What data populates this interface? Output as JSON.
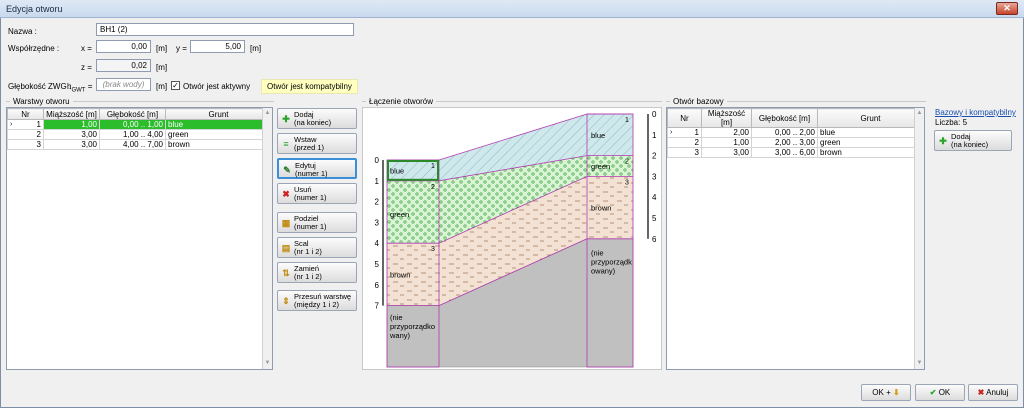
{
  "window": {
    "title": "Edycja otworu",
    "close_glyph": "✕"
  },
  "form": {
    "name_label": "Nazwa :",
    "name_value": "BH1 (2)",
    "coords_label": "Współrzędne :",
    "x_label": "x =",
    "x_value": "0,00",
    "y_label": "y =",
    "y_value": "5,00",
    "z_label": "z =",
    "z_value": "0,02",
    "unit_m": "[m]",
    "gwt_label": "Głębokość ZWG :",
    "gwt_symbol": "h",
    "gwt_sub": "GWT",
    "gwt_eq": "=",
    "gwt_placeholder": "(brak wody)",
    "active_checkbox_label": "Otwór jest aktywny",
    "active_checked": true,
    "compat_note": "Otwór jest kompatybilny"
  },
  "layers_panel": {
    "title": "Warstwy otworu",
    "columns": [
      "Nr",
      "Miąższość [m]",
      "Głębokość [m]",
      "Grunt"
    ],
    "rows": [
      {
        "nr": "1",
        "thickness": "1,00",
        "depth": "0,00 .. 1,00",
        "soil": "blue",
        "selected": true
      },
      {
        "nr": "2",
        "thickness": "3,00",
        "depth": "1,00 .. 4,00",
        "soil": "green",
        "selected": false
      },
      {
        "nr": "3",
        "thickness": "3,00",
        "depth": "4,00 .. 7,00",
        "soil": "brown",
        "selected": false
      }
    ]
  },
  "actions": [
    {
      "name": "add",
      "line1": "Dodaj",
      "line2": "(na koniec)",
      "icon": "plus-icon"
    },
    {
      "name": "insert",
      "line1": "Wstaw",
      "line2": "(przed 1)",
      "icon": "insert-icon"
    },
    {
      "name": "edit",
      "line1": "Edytuj",
      "line2": "(numer 1)",
      "icon": "pencil-icon"
    },
    {
      "name": "delete",
      "line1": "Usuń",
      "line2": "(numer 1)",
      "icon": "delete-icon"
    },
    {
      "name": "split",
      "line1": "Podziel",
      "line2": "(numer 1)",
      "icon": "split-icon"
    },
    {
      "name": "merge",
      "line1": "Scal",
      "line2": "(nr 1 i 2)",
      "icon": "merge-icon"
    },
    {
      "name": "swap",
      "line1": "Zamień",
      "line2": "(nr 1 i 2)",
      "icon": "swap-icon"
    },
    {
      "name": "move-boundary",
      "line1": "Przesuń warstwę",
      "line2": "(między 1 i 2)",
      "icon": "move-icon"
    }
  ],
  "connection": {
    "title": "Łączenie otworów",
    "left_scale": [
      "0",
      "1",
      "2",
      "3",
      "4",
      "5",
      "6",
      "7"
    ],
    "right_scale": [
      "0",
      "1",
      "2",
      "3",
      "4",
      "5",
      "6"
    ],
    "left_labels": {
      "blue": "blue",
      "green": "green",
      "brown": "brown",
      "unassigned_1": "(nie",
      "unassigned_2": "przyporządko",
      "unassigned_3": "wany)"
    },
    "right_labels": {
      "blue": "blue",
      "green": "green",
      "brown": "brown",
      "unassigned_1": "(nie",
      "unassigned_2": "przyporządk",
      "unassigned_3": "owany)"
    },
    "nums": [
      "1",
      "2",
      "3"
    ],
    "colors": {
      "blue": "#cfe8ec",
      "green": "#d9f5d5",
      "brown": "#f3e2d3",
      "unassigned": "#c0c0c0",
      "boundary": "#b03bb0"
    }
  },
  "base_panel": {
    "title": "Otwór bazowy",
    "columns": [
      "Nr",
      "Miąższość [m]",
      "Głębokość [m]",
      "Grunt"
    ],
    "rows": [
      {
        "nr": "1",
        "thickness": "2,00",
        "depth": "0,00 .. 2,00",
        "soil": "blue"
      },
      {
        "nr": "2",
        "thickness": "1,00",
        "depth": "2,00 .. 3,00",
        "soil": "green"
      },
      {
        "nr": "3",
        "thickness": "3,00",
        "depth": "3,00 .. 6,00",
        "soil": "brown"
      }
    ],
    "side_title": "Bazowy i kompatybilny",
    "count_label": "Liczba: 5",
    "add_line1": "Dodaj",
    "add_line2": "(na koniec)"
  },
  "footer": {
    "ok_plus": "OK +",
    "ok": "OK",
    "cancel": "Anuluj"
  }
}
